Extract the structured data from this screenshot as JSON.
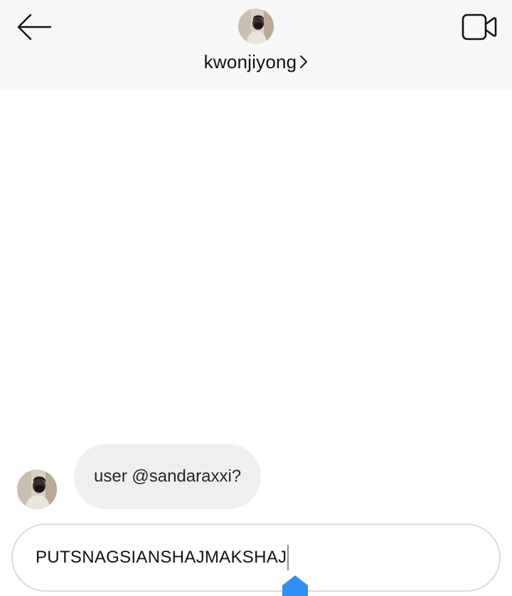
{
  "header": {
    "username": "kwonjiyong",
    "back_icon": "arrow-left-icon",
    "video_icon": "video-camera-icon",
    "chevron_icon": "chevron-right-icon"
  },
  "messages": [
    {
      "from": "kwonjiyong",
      "text": "user @sandaraxxi?"
    }
  ],
  "composer": {
    "value": "PUTSNAGSIANSHAJMAKSHAJ"
  },
  "colors": {
    "header_bg": "#f7f7f7",
    "bubble_bg": "#efefef",
    "composer_border": "#dbdbdb",
    "text_selection_handle": "#2f8ef7"
  }
}
